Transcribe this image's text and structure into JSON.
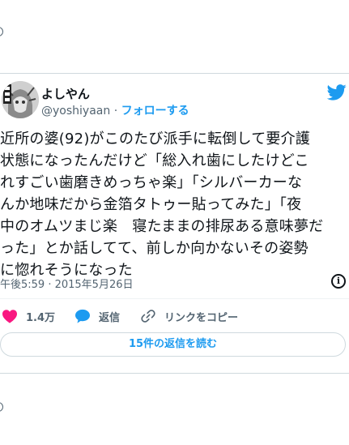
{
  "tweet": {
    "author": {
      "name": "よしやん",
      "handle": "@yoshiyaan",
      "separator": "·",
      "follow_label": "フォローする"
    },
    "text": "近所の婆(92)がこのたび派手に転倒して要介護\n状態になったんだけど「総入れ歯にしたけどこ\nれすごい歯磨きめっちゃ楽」「シルバーカーな\nんか地味だから金箔タトゥー貼ってみた」「夜\n中のオムツまじ楽　寝たままの排尿ある意味夢だ\nった」とか話してて、前しか向かないその姿勢\nに惚れそうになった",
    "timestamp": "午後5:59 · 2015年5月26日",
    "actions": {
      "like_count": "1.4万",
      "reply_label": "返信",
      "copy_link_label": "リンクをコピー"
    },
    "read_replies_label": "15件の返信を読む"
  },
  "icons": {
    "brand": "twitter-bird-icon",
    "like": "heart-icon",
    "reply": "speech-bubble-icon",
    "copy_link": "link-icon",
    "info": "info-icon"
  },
  "colors": {
    "accent": "#1d9bf0",
    "like": "#f91880",
    "text": "#0f1419",
    "muted": "#536471",
    "border": "#cfd9de"
  }
}
